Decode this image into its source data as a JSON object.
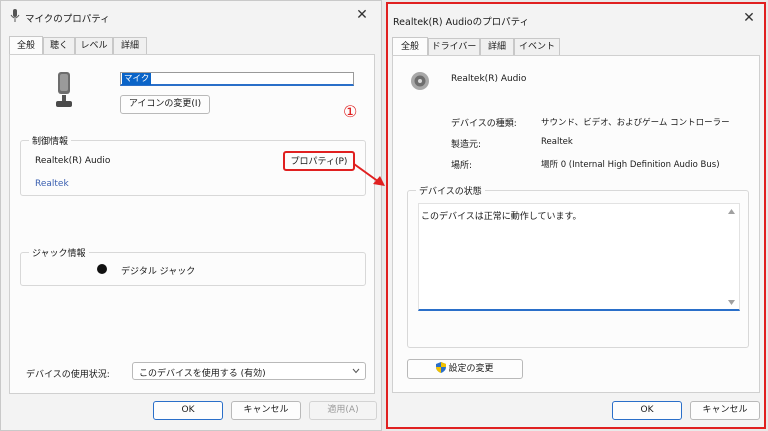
{
  "left_dialog": {
    "title": "マイクのプロパティ",
    "tabs": [
      "全般",
      "聴く",
      "レベル",
      "詳細"
    ],
    "device_name_value": "マイク",
    "change_icon_button": "アイコンの変更(I)",
    "controller_group_label": "制御情報",
    "controller_name": "Realtek(R) Audio",
    "controller_link": "Realtek",
    "properties_button": "プロパティ(P)",
    "jack_group_label": "ジャック情報",
    "jack_text": "デジタル ジャック",
    "usage_label": "デバイスの使用状況:",
    "usage_value": "このデバイスを使用する (有効)",
    "ok_button": "OK",
    "cancel_button": "キャンセル",
    "apply_button": "適用(A)"
  },
  "annotation": {
    "marker": "①",
    "color": "#e02020"
  },
  "right_dialog": {
    "title": "Realtek(R) Audioのプロパティ",
    "tabs": [
      "全般",
      "ドライバー",
      "詳細",
      "イベント"
    ],
    "device_name": "Realtek(R) Audio",
    "info": [
      {
        "label": "デバイスの種類:",
        "value": "サウンド、ビデオ、およびゲーム コントローラー"
      },
      {
        "label": "製造元:",
        "value": "Realtek"
      },
      {
        "label": "場所:",
        "value": "場所 0 (Internal High Definition Audio Bus)"
      }
    ],
    "status_group_label": "デバイスの状態",
    "status_text": "このデバイスは正常に動作しています。",
    "change_settings_button": "設定の変更",
    "ok_button": "OK",
    "cancel_button": "キャンセル"
  },
  "colors": {
    "accent": "#2a6fc9",
    "annotation_red": "#e02020",
    "link_blue": "#3a5fb0"
  },
  "icons": [
    "microphone-icon",
    "speaker-icon",
    "shield-icon",
    "close-icon",
    "chevron-down-icon",
    "scroll-up-icon",
    "scroll-down-icon"
  ]
}
